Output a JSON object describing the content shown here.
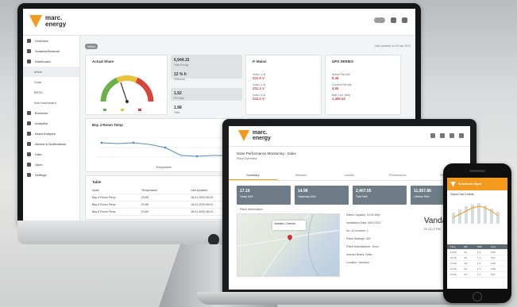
{
  "monitor": {
    "brand": {
      "line1": "marc.",
      "line2": "energy"
    },
    "sidebar": {
      "items": [
        {
          "label": "Overview"
        },
        {
          "label": "Solarlink/Network"
        },
        {
          "label": "Dashboard"
        },
        {
          "label": "eMon"
        },
        {
          "label": "Solar"
        },
        {
          "label": "BESS"
        },
        {
          "label": "Add Dashboard"
        },
        {
          "label": "Business"
        },
        {
          "label": "Analytics"
        },
        {
          "label": "Asset Analysis"
        },
        {
          "label": "Alarms & Notifications"
        },
        {
          "label": "Data"
        },
        {
          "label": "Open"
        },
        {
          "label": "Settings"
        }
      ]
    },
    "page": {
      "chip": "eMon",
      "note": "Last updated on 18 Jan 2020"
    },
    "gauge_card": {
      "title": "Actual Share"
    },
    "tiles": [
      {
        "value": "6,944.15",
        "label": "Total Energy"
      },
      {
        "value": "12 % h",
        "label": "Efficiency"
      },
      {
        "value": "1.92",
        "label": "PR Ratio"
      },
      {
        "value": "1.98",
        "label": "Yield"
      }
    ],
    "metrics_card_1": {
      "title": "P. Mains",
      "rows": [
        {
          "label": "Volts L1-N",
          "value": "231.9 V"
        },
        {
          "label": "Volts L2-N",
          "value": "231.4 V"
        },
        {
          "label": "Volts L3-N",
          "value": "232.2 V"
        }
      ]
    },
    "metrics_card_2": {
      "title": "UPS SERIES",
      "rows": [
        {
          "label": "Active Pwr kW",
          "value": "8.48"
        },
        {
          "label": "Current Pwr kW",
          "value": "4.90"
        },
        {
          "label": "Batt Curr. (kW)",
          "value": "1,490.45"
        }
      ]
    },
    "temp_card": {
      "title": "Bay 4 Room Temp",
      "legend": "Temperature"
    },
    "spark_card": {
      "title": "Sampalo Main"
    },
    "table": {
      "title": "Table",
      "headers": [
        "Node",
        "Temperature",
        "Last Updated"
      ],
      "rows": [
        [
          "Bay 4 Room Temp",
          "23.88",
          "18-01-2020 06:22"
        ],
        [
          "Bay 5 Room Temp",
          "23.85",
          "18-01-2020 06:22"
        ],
        [
          "Bay 6 Room Temp",
          "23.82",
          "18-01-2020 06:22"
        ]
      ]
    }
  },
  "laptop": {
    "brand": {
      "line1": "marc.",
      "line2": "energy"
    },
    "title": "Solar Performance Monitoring - Index",
    "subtitle": "Plant Overview",
    "tabs": [
      "Summary",
      "Weather",
      "Inverter",
      "Performance",
      "Financial"
    ],
    "kpis": [
      {
        "value": "17.19",
        "label": "Today kWh"
      },
      {
        "value": "14.98",
        "label": "Yesterday kWh"
      },
      {
        "value": "2,407.05",
        "label": "Total kWh"
      },
      {
        "value": "11,957.86",
        "label": "Lifetime kWh"
      }
    ],
    "map_label": "Plant Information",
    "map_popup": "Vandalur, Chennai",
    "info_rows": [
      "Rated Capacity: 10.00 kWp",
      "Installation Date: 08/07/2017",
      "No. of Inverters: 1",
      "Panel Wattage: 325",
      "Panel Manufacturer: Jinko",
      "Inverter Brand: Delta",
      "Location: Vandalur"
    ],
    "city": "Vandalur, IN",
    "city_sub": "Fri 12:17 PM",
    "big_value": "36"
  },
  "phone": {
    "header": "Sustainable Mgmt",
    "subtitle": "Output Cost Controls",
    "table_head": [
      "Time",
      "kW",
      "kWh",
      "Cost"
    ],
    "rows": [
      [
        "12:00",
        "4.2",
        "1.0",
        "0.25"
      ],
      [
        "12:15",
        "4.5",
        "1.1",
        "0.27"
      ],
      [
        "12:30",
        "4.8",
        "1.2",
        "0.29"
      ],
      [
        "12:45",
        "4.6",
        "1.1",
        "0.28"
      ],
      [
        "13:00",
        "4.4",
        "1.1",
        "0.27"
      ]
    ]
  }
}
